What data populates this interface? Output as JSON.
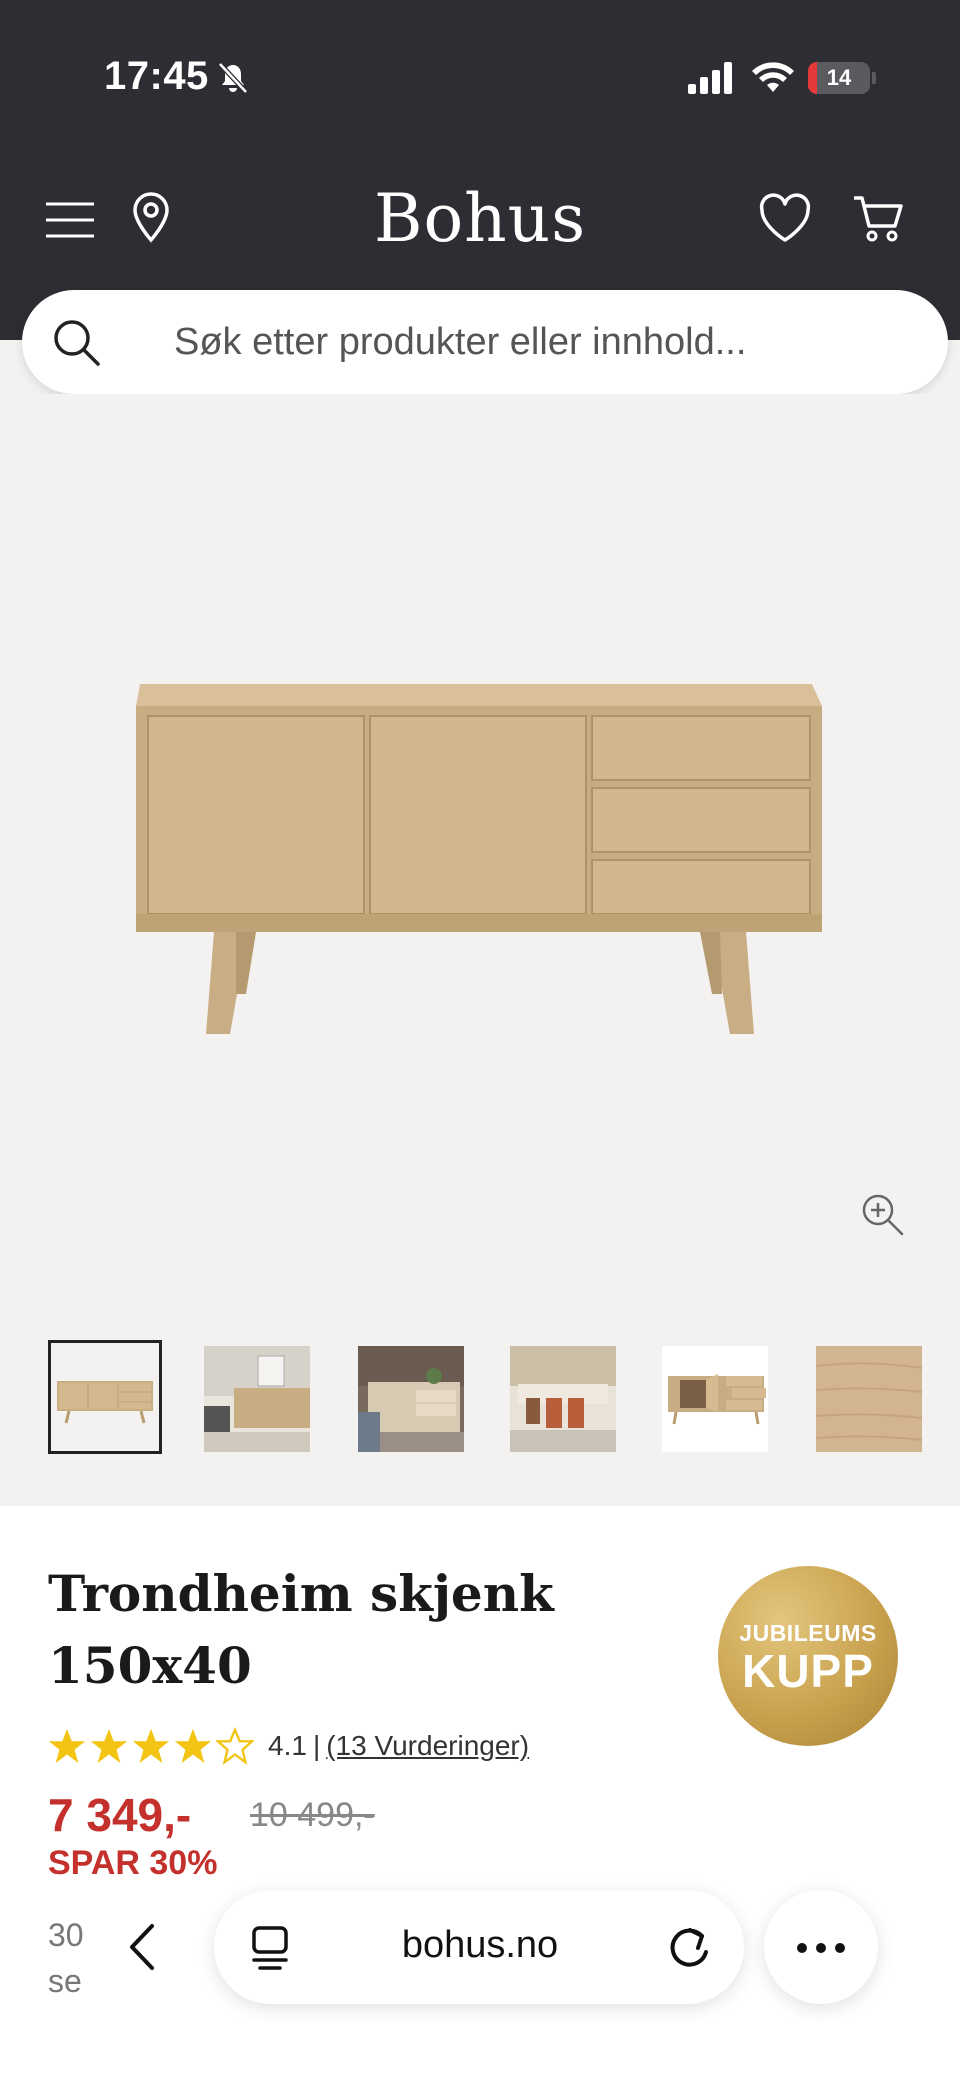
{
  "status_bar": {
    "time": "17:45",
    "battery": "14",
    "battery_level": 0.14
  },
  "header": {
    "logo": "Bohus"
  },
  "search": {
    "placeholder": "Søk etter produkter eller innhold..."
  },
  "product": {
    "title_line1": "Trondheim skjenk",
    "title_line2": "150x40",
    "badge_line1": "JUBILEUMS",
    "badge_line2": "KUPP",
    "rating_value": "4.1",
    "rating_separator": "|",
    "rating_count_label": "(13 Vurderinger)",
    "stars_filled": 4,
    "stars_total": 5,
    "price": "7 349,-",
    "old_price": "10 499,-",
    "save_label": "SPAR 30%",
    "desc_line1": "30",
    "desc_line2": "se"
  },
  "gallery": {
    "thumbnail_count": 6,
    "selected_index": 0
  },
  "browser": {
    "url": "bohus.no"
  }
}
